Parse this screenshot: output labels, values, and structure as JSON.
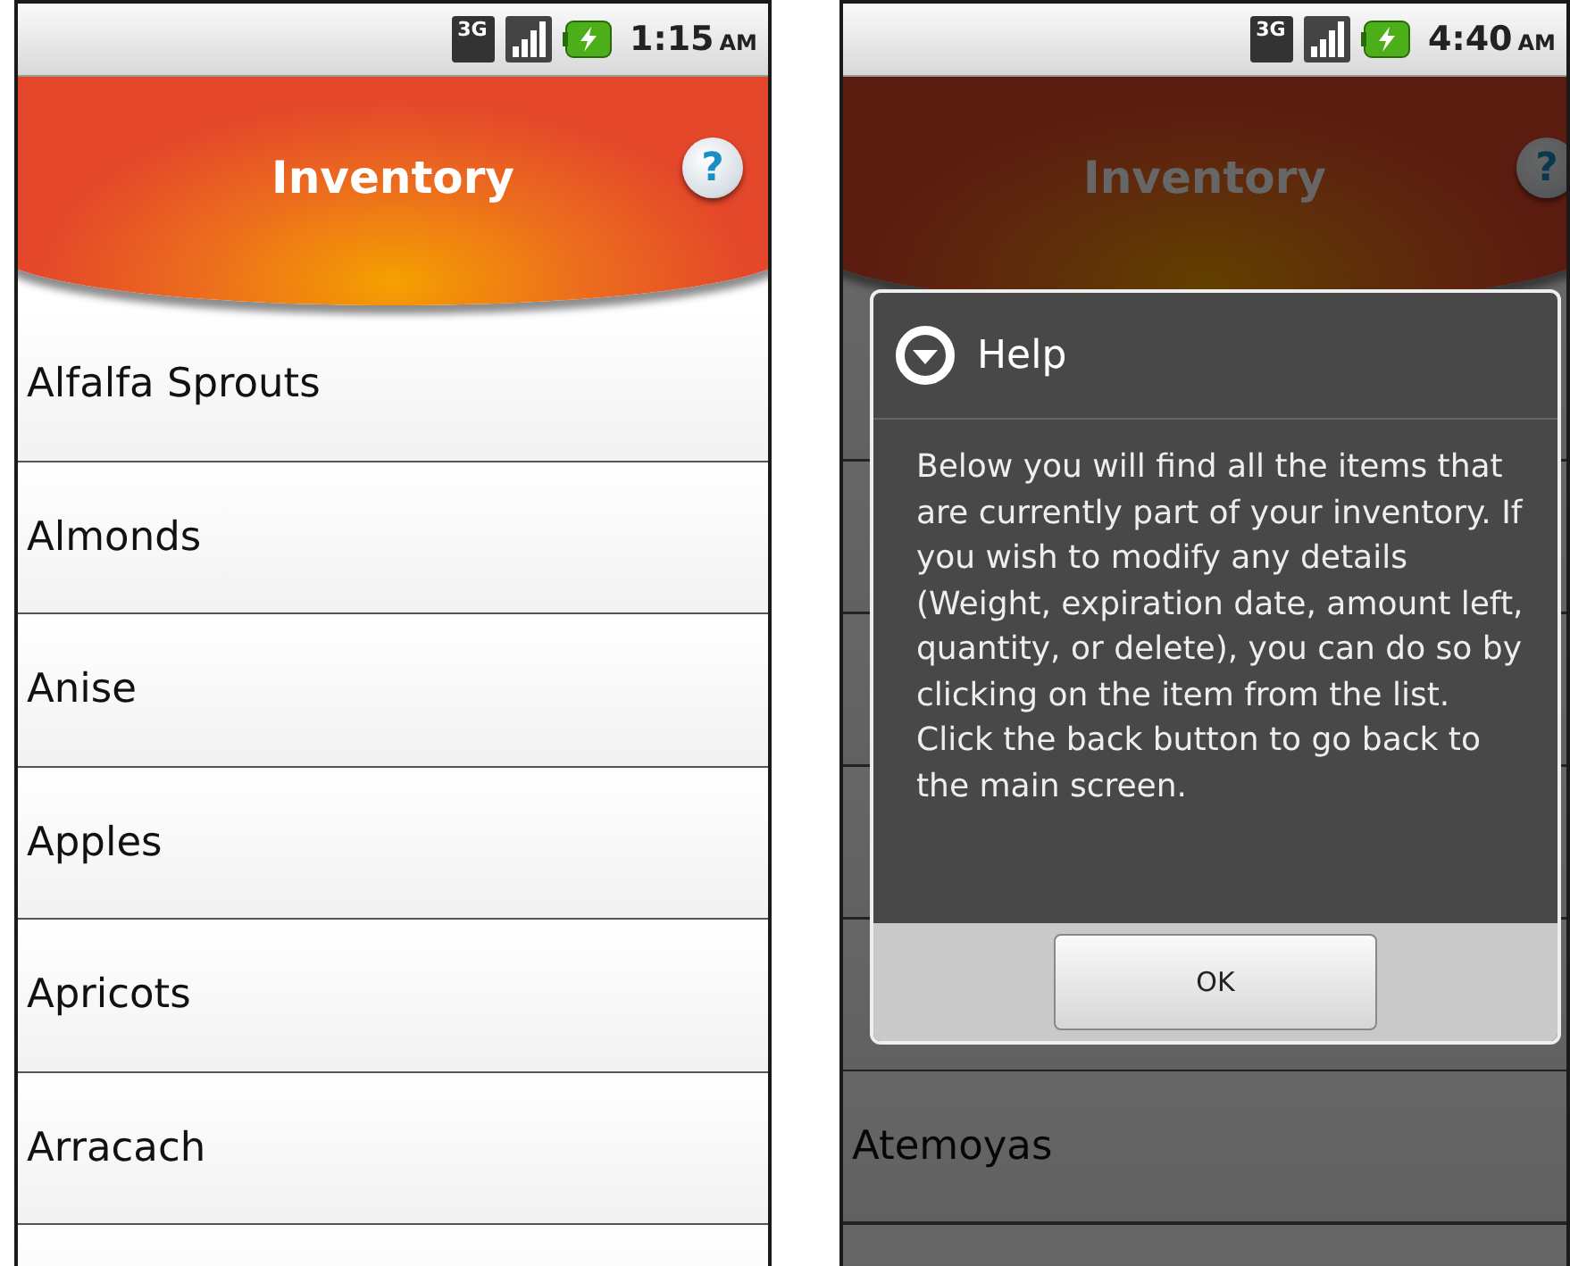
{
  "screens": [
    {
      "status_bar": {
        "network": "3G",
        "time": "1:15",
        "meridiem": "AM"
      },
      "header": {
        "title": "Inventory",
        "help_glyph": "?"
      },
      "dimmed": false,
      "items": [
        {
          "label": "Alfalfa Sprouts"
        },
        {
          "label": "Almonds"
        },
        {
          "label": "Anise"
        },
        {
          "label": "Apples"
        },
        {
          "label": "Apricots"
        },
        {
          "label": "Arracach"
        }
      ]
    },
    {
      "status_bar": {
        "network": "3G",
        "time": "4:40",
        "meridiem": "AM"
      },
      "header": {
        "title": "Inventory",
        "help_glyph": "?"
      },
      "dimmed": true,
      "items": [
        {
          "label": "Atemoyas"
        }
      ],
      "dialog": {
        "title": "Help",
        "body": "Below you will find all the items that are currently part of your inventory. If you wish to modify any details (Weight, expiration date, amount left, quantity, or delete), you can do so by clicking on the item from the list. Click the back button to go back to the main screen.",
        "button": "OK"
      }
    }
  ]
}
